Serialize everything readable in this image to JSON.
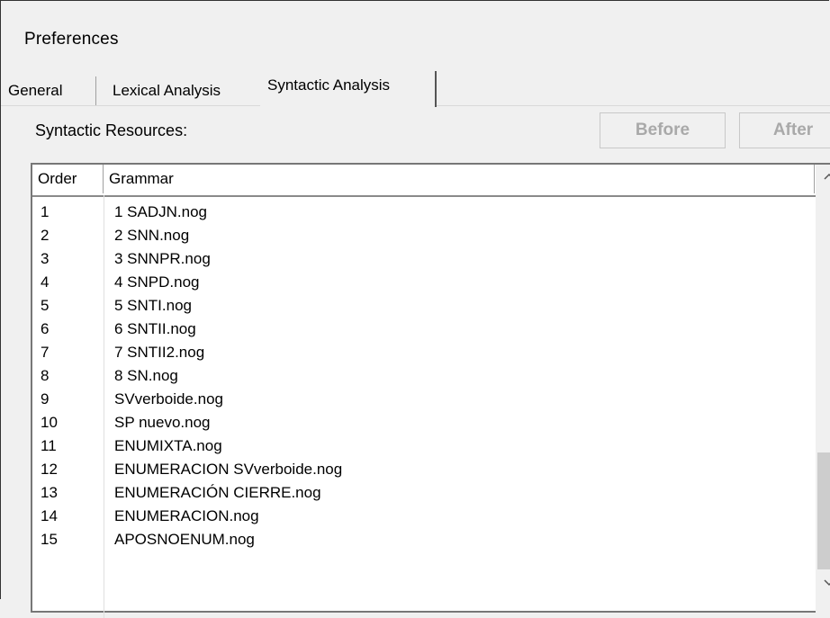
{
  "window": {
    "title": "Preferences"
  },
  "tabs": [
    {
      "label": "General",
      "active": false
    },
    {
      "label": "Lexical Analysis",
      "active": false
    },
    {
      "label": "Syntactic Analysis",
      "active": true
    }
  ],
  "syntactic": {
    "resources_label": "Syntactic Resources:",
    "before_label": "Before",
    "after_label": "After",
    "columns": {
      "order": "Order",
      "grammar": "Grammar"
    },
    "rows": [
      {
        "order": "1",
        "grammar": "1 SADJN.nog"
      },
      {
        "order": "2",
        "grammar": "2 SNN.nog"
      },
      {
        "order": "3",
        "grammar": "3 SNNPR.nog"
      },
      {
        "order": "4",
        "grammar": "4 SNPD.nog"
      },
      {
        "order": "5",
        "grammar": "5 SNTI.nog"
      },
      {
        "order": "6",
        "grammar": "6 SNTII.nog"
      },
      {
        "order": "7",
        "grammar": "7 SNTII2.nog"
      },
      {
        "order": "8",
        "grammar": "8 SN.nog"
      },
      {
        "order": "9",
        "grammar": "SVverboide.nog"
      },
      {
        "order": "10",
        "grammar": "SP nuevo.nog"
      },
      {
        "order": "11",
        "grammar": "ENUMIXTA.nog"
      },
      {
        "order": "12",
        "grammar": "ENUMERACION SVverboide.nog"
      },
      {
        "order": "13",
        "grammar": "ENUMERACIÓN CIERRE.nog"
      },
      {
        "order": "14",
        "grammar": "ENUMERACION.nog"
      },
      {
        "order": "15",
        "grammar": "APOSNOENUM.nog"
      }
    ]
  },
  "icons": {
    "scroll_up": "chevron-up-icon",
    "scroll_down": "chevron-down-icon"
  },
  "colors": {
    "window_bg": "#f0f0f0",
    "list_bg": "#ffffff",
    "disabled_text": "#a9a9a9"
  }
}
